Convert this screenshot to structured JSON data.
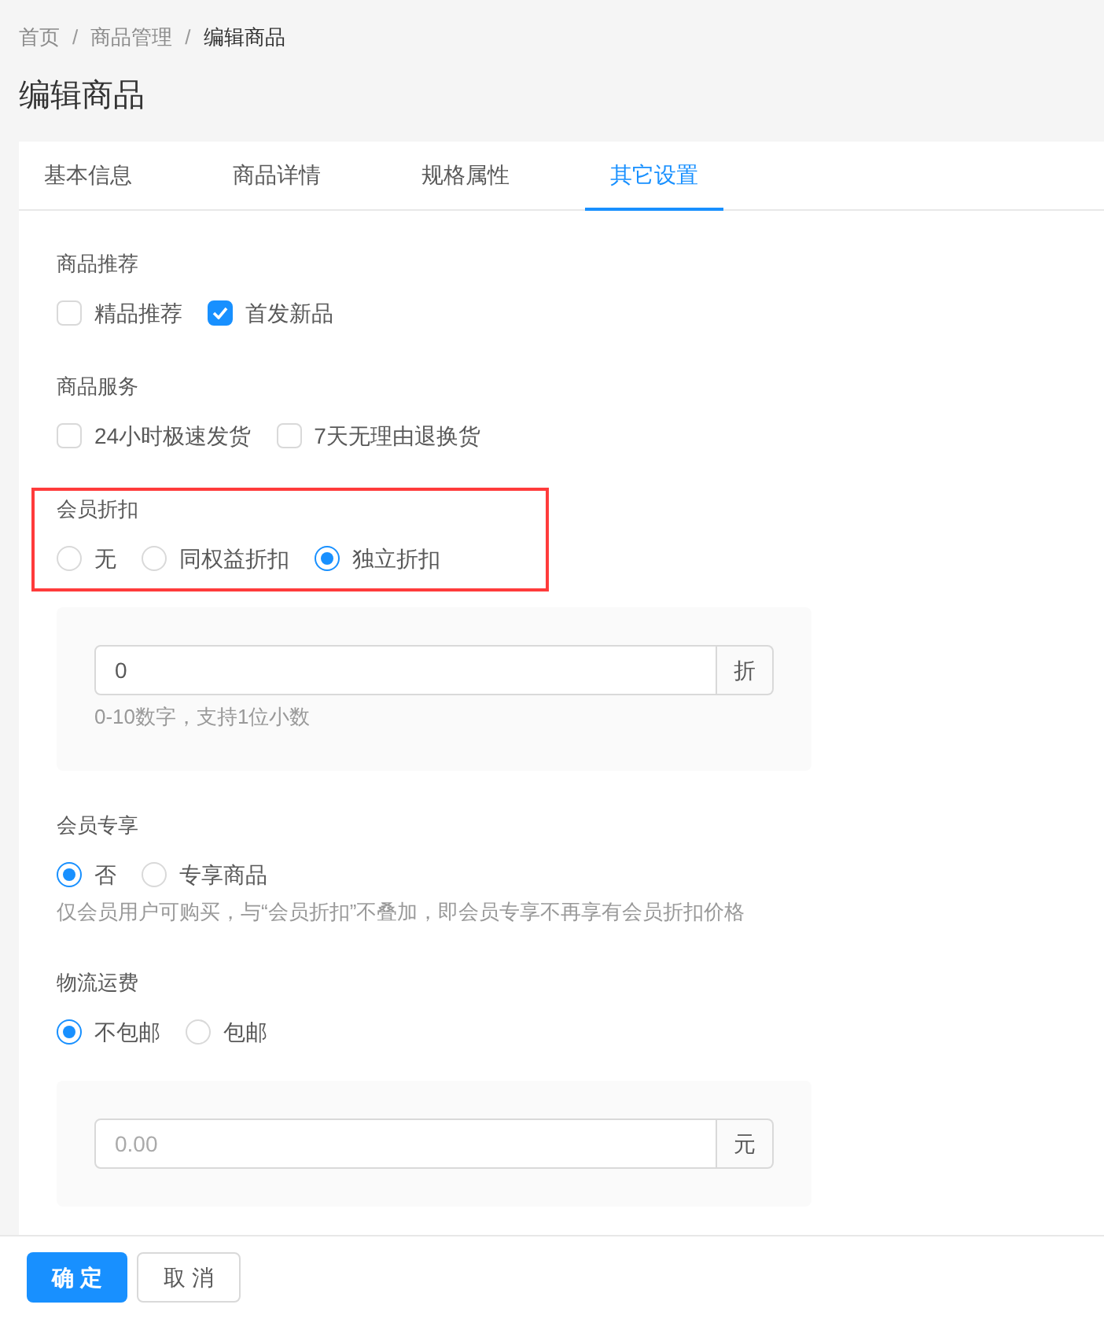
{
  "breadcrumb": [
    {
      "label": "首页",
      "current": false
    },
    {
      "label": "商品管理",
      "current": false
    },
    {
      "label": "编辑商品",
      "current": true
    }
  ],
  "breadcrumb_separator": "/",
  "page_title": "编辑商品",
  "tabs": [
    {
      "label": "基本信息",
      "selected": false
    },
    {
      "label": "商品详情",
      "selected": false
    },
    {
      "label": "规格属性",
      "selected": false
    },
    {
      "label": "其它设置",
      "selected": true
    }
  ],
  "sections": [
    {
      "label": "商品推荐",
      "kind": "checkbox",
      "highlighted": false,
      "options": [
        {
          "label": "精品推荐",
          "checked": false
        },
        {
          "label": "首发新品",
          "checked": true
        }
      ]
    },
    {
      "label": "商品服务",
      "kind": "checkbox",
      "highlighted": false,
      "options": [
        {
          "label": "24小时极速发货",
          "checked": false
        },
        {
          "label": "7天无理由退换货",
          "checked": false
        }
      ]
    },
    {
      "label": "会员折扣",
      "kind": "radio",
      "highlighted": true,
      "options": [
        {
          "label": "无",
          "selected": false
        },
        {
          "label": "同权益折扣",
          "selected": false
        },
        {
          "label": "独立折扣",
          "selected": true
        }
      ],
      "panel": {
        "value": "0",
        "suffix": "折",
        "hint": "0-10数字，支持1位小数"
      }
    },
    {
      "label": "会员专享",
      "kind": "radio",
      "highlighted": false,
      "options": [
        {
          "label": "否",
          "selected": true
        },
        {
          "label": "专享商品",
          "selected": false
        }
      ],
      "hint": "仅会员用户可购买，与“会员折扣”不叠加，即会员专享不再享有会员折扣价格"
    },
    {
      "label": "物流运费",
      "kind": "radio",
      "highlighted": false,
      "options": [
        {
          "label": "不包邮",
          "selected": true
        },
        {
          "label": "包邮",
          "selected": false
        }
      ],
      "panel": {
        "placeholder": "0.00",
        "suffix": "元"
      }
    }
  ],
  "footer_buttons": [
    {
      "label": "确 定",
      "kind": "primary"
    },
    {
      "label": "取 消",
      "kind": "default"
    }
  ]
}
